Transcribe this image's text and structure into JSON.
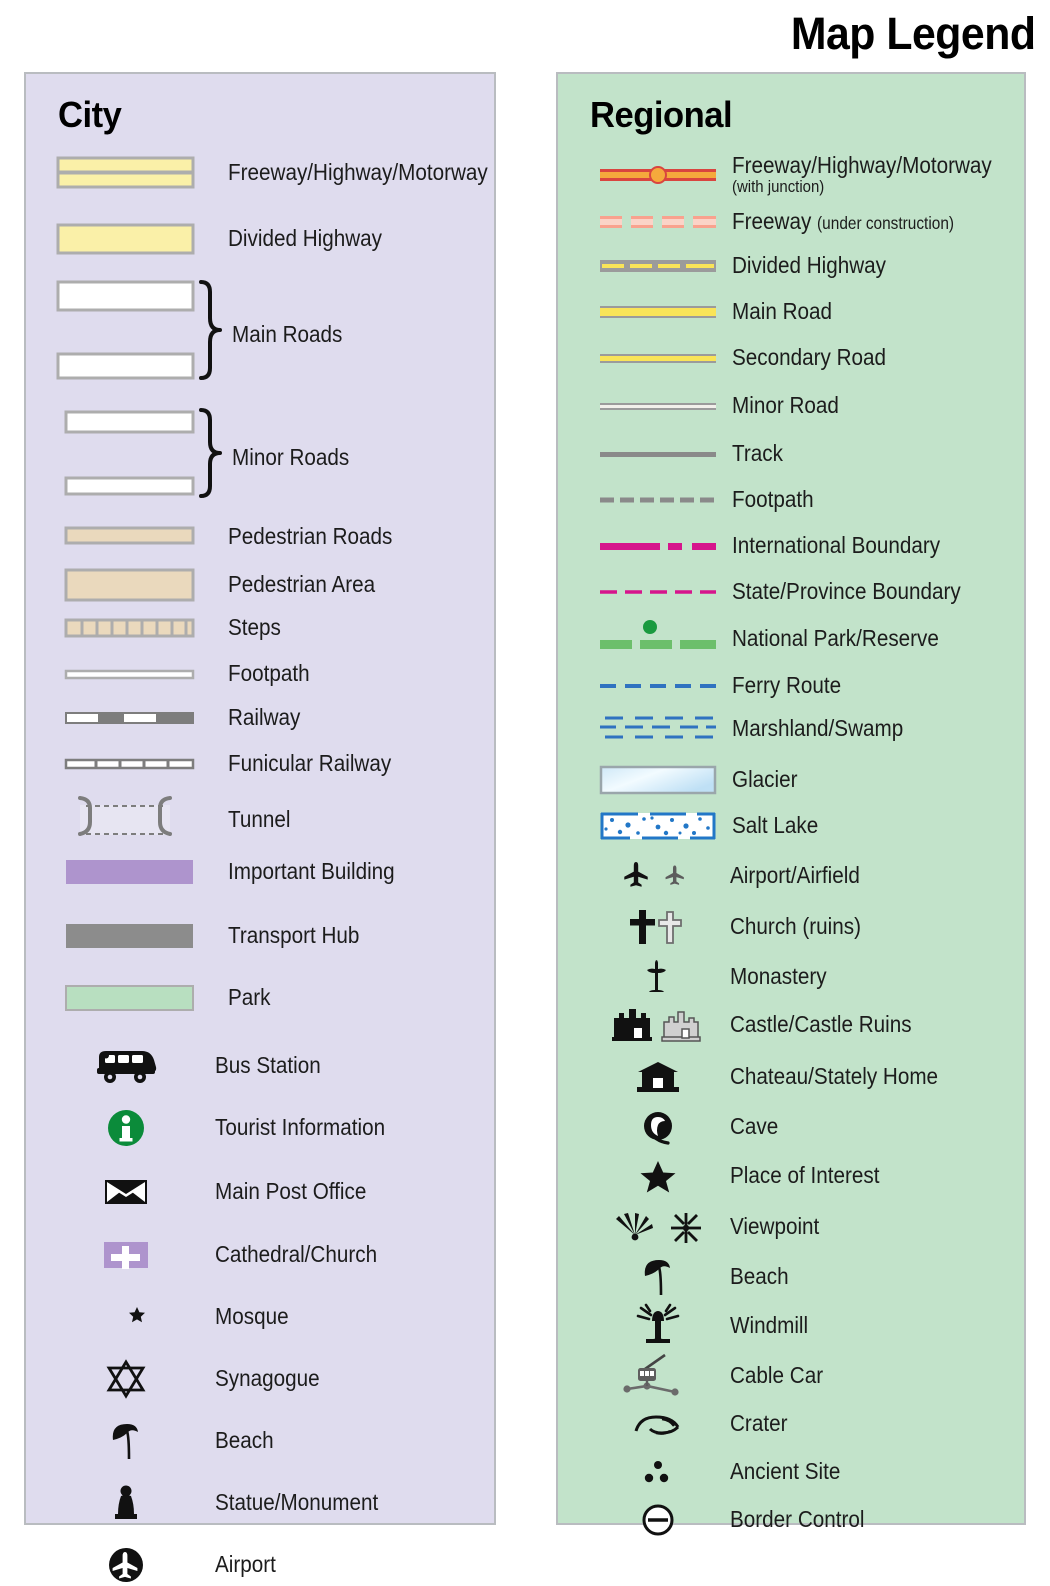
{
  "header": {
    "title": "Map Legend"
  },
  "city": {
    "title": "City",
    "bg_color": "#dfdcee",
    "items": [
      {
        "label": "Freeway/Highway/Motorway",
        "symbol": "freeway-double-band"
      },
      {
        "label": "Divided Highway",
        "symbol": "divided-highway-band"
      },
      {
        "label": "Main Roads",
        "symbol": "main-roads-brace"
      },
      {
        "label": "Minor Roads",
        "symbol": "minor-roads-brace"
      },
      {
        "label": "Pedestrian Roads",
        "symbol": "pedestrian-road-band"
      },
      {
        "label": "Pedestrian Area",
        "symbol": "pedestrian-area-block"
      },
      {
        "label": "Steps",
        "symbol": "steps-band"
      },
      {
        "label": "Footpath",
        "symbol": "footpath-line"
      },
      {
        "label": "Railway",
        "symbol": "railway-line"
      },
      {
        "label": "Funicular Railway",
        "symbol": "funicular-railway-line"
      },
      {
        "label": "Tunnel",
        "symbol": "tunnel-bracket"
      },
      {
        "label": "Important Building",
        "symbol": "important-building-swatch"
      },
      {
        "label": "Transport Hub",
        "symbol": "transport-hub-swatch"
      },
      {
        "label": "Park",
        "symbol": "park-swatch"
      },
      {
        "label": "Bus Station",
        "symbol": "bus-icon"
      },
      {
        "label": "Tourist Information",
        "symbol": "information-icon"
      },
      {
        "label": "Main Post Office",
        "symbol": "envelope-icon"
      },
      {
        "label": "Cathedral/Church",
        "symbol": "cathedral-cross-icon"
      },
      {
        "label": "Mosque",
        "symbol": "crescent-star-icon"
      },
      {
        "label": "Synagogue",
        "symbol": "star-of-david-icon"
      },
      {
        "label": "Beach",
        "symbol": "beach-umbrella-icon"
      },
      {
        "label": "Statue/Monument",
        "symbol": "statue-icon"
      },
      {
        "label": "Airport",
        "symbol": "airport-circle-icon"
      }
    ]
  },
  "regional": {
    "title": "Regional",
    "bg_color": "#c2e3ca",
    "items": [
      {
        "label": "Freeway/Highway/Motorway",
        "sublabel": "(with junction)",
        "symbol": "freeway-junction-line"
      },
      {
        "label": "Freeway",
        "inline_note": "(under construction)",
        "symbol": "freeway-construction-dashes"
      },
      {
        "label": "Divided Highway",
        "symbol": "divided-highway-dashed-line"
      },
      {
        "label": "Main Road",
        "symbol": "main-road-line"
      },
      {
        "label": "Secondary Road",
        "symbol": "secondary-road-line"
      },
      {
        "label": "Minor Road",
        "symbol": "minor-road-line"
      },
      {
        "label": "Track",
        "symbol": "track-line"
      },
      {
        "label": "Footpath",
        "symbol": "footpath-dashed-line"
      },
      {
        "label": "International Boundary",
        "symbol": "international-boundary-line"
      },
      {
        "label": "State/Province Boundary",
        "symbol": "state-boundary-line"
      },
      {
        "label": "National Park/Reserve",
        "symbol": "national-park-line"
      },
      {
        "label": "Ferry Route",
        "symbol": "ferry-route-line"
      },
      {
        "label": "Marshland/Swamp",
        "symbol": "marshland-pattern"
      },
      {
        "label": "Glacier",
        "symbol": "glacier-swatch"
      },
      {
        "label": "Salt Lake",
        "symbol": "salt-lake-swatch"
      },
      {
        "label": "Airport/Airfield",
        "symbol": "plane-icons"
      },
      {
        "label": "Church (ruins)",
        "symbol": "church-cross-icons"
      },
      {
        "label": "Monastery",
        "symbol": "monastery-cross-icon"
      },
      {
        "label": "Castle/Castle Ruins",
        "symbol": "castle-icons"
      },
      {
        "label": "Chateau/Stately Home",
        "symbol": "chateau-icon"
      },
      {
        "label": "Cave",
        "symbol": "cave-icon"
      },
      {
        "label": "Place of Interest",
        "symbol": "star-icon"
      },
      {
        "label": "Viewpoint",
        "symbol": "viewpoint-icons"
      },
      {
        "label": "Beach",
        "symbol": "beach-umbrella-icon"
      },
      {
        "label": "Windmill",
        "symbol": "windmill-icon"
      },
      {
        "label": "Cable Car",
        "symbol": "cable-car-icon"
      },
      {
        "label": "Crater",
        "symbol": "crater-icon"
      },
      {
        "label": "Ancient Site",
        "symbol": "ancient-site-dots-icon"
      },
      {
        "label": "Border Control",
        "symbol": "border-control-icon"
      }
    ]
  },
  "colors": {
    "city_panel": "#dfdcee",
    "regional_panel": "#c2e3ca",
    "panel_border": "#b9bcc0",
    "road_yellow": "#faf0a8",
    "road_casing": "#adadad",
    "pedestrian_tan": "#ead9bd",
    "important_building": "#ae94cd",
    "transport_hub": "#8c8c8c",
    "park_green": "#b8dfc0",
    "tourist_info_green": "#0b8b3a",
    "freeway_red": "#d9453f",
    "freeway_orange": "#f5a93c",
    "construction_pink": "#f9a28e",
    "main_road_yellow": "#f9e458",
    "boundary_magenta": "#d6158c",
    "national_park_green": "#6cbf6b",
    "ferry_blue": "#2f72c0",
    "glacier_blue": "#cfe8f7",
    "salt_lake_blue": "#2277c7"
  }
}
